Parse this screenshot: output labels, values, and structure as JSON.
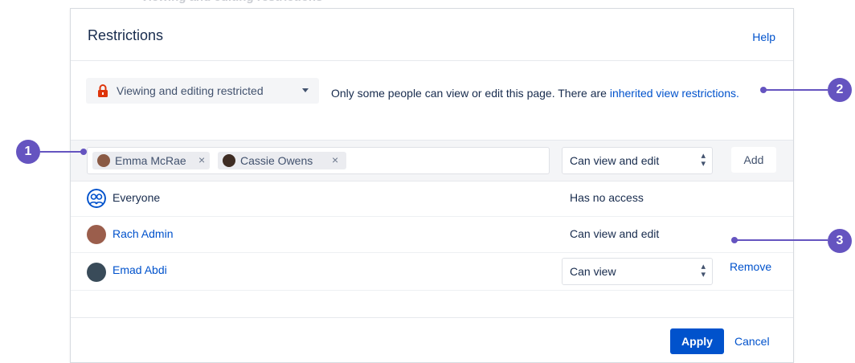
{
  "background_text": "Viewing and editing restrictions",
  "dialog": {
    "title": "Restrictions",
    "help_label": "Help"
  },
  "restriction_mode": {
    "label": "Viewing and editing restricted",
    "icon": "lock-icon",
    "icon_color": "#de350b"
  },
  "notice": {
    "text": "Only some people can view or edit this page. There are ",
    "link_text": "inherited view restrictions."
  },
  "add_row": {
    "chips": [
      {
        "name": "Emma McRae",
        "remove_glyph": "×",
        "avatar_color": "#8a5a44"
      },
      {
        "name": "Cassie Owens",
        "remove_glyph": "×",
        "avatar_color": "#3e2c23"
      }
    ],
    "permission": "Can view and edit",
    "select_arrows": "▴▾",
    "add_label": "Add"
  },
  "rows": [
    {
      "name": "Everyone",
      "permission": "Has no access",
      "icon": "group-icon"
    },
    {
      "name": "Rach Admin",
      "permission": "Can view and edit",
      "avatar_color": "#9b5e4c"
    },
    {
      "name": "Emad Abdi",
      "permission": "Can view",
      "avatar_color": "#394b59",
      "remove_label": "Remove"
    }
  ],
  "footer": {
    "apply_label": "Apply",
    "cancel_label": "Cancel"
  },
  "callouts": [
    "1",
    "2",
    "3"
  ],
  "colors": {
    "primary": "#0052cc",
    "callout": "#6554c0",
    "danger": "#de350b"
  }
}
